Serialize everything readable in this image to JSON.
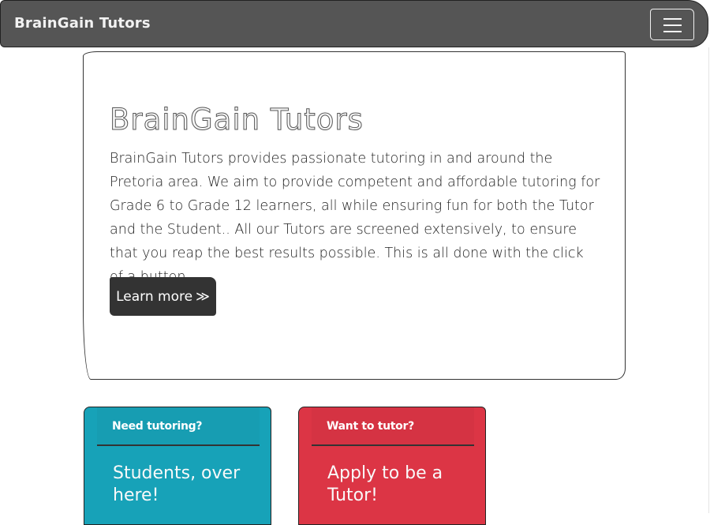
{
  "navbar": {
    "brand": "BrainGain Tutors",
    "toggler_icon": "hamburger-menu-icon"
  },
  "jumbotron": {
    "title": "BrainGain Tutors",
    "text": "BrainGain Tutors provides passionate tutoring in and around the Pretoria area. We aim to provide competent and affordable tutoring for Grade 6 to Grade 12 learners, all while ensuring fun for both the Tutor and the Student.. All our Tutors are screened extensively, to ensure that you reap the best results possible. This is all done with the click of a button.",
    "button_label": "Learn more",
    "button_icon": "double-chevron-right-icon"
  },
  "cards": [
    {
      "header": "Need tutoring?",
      "title": "Students, over here!",
      "color": "#17a2b8"
    },
    {
      "header": "Want to tutor?",
      "title": "Apply to be a Tutor!",
      "color": "#dc3545"
    }
  ],
  "colors": {
    "navbar": "#555555",
    "button": "#333333"
  }
}
